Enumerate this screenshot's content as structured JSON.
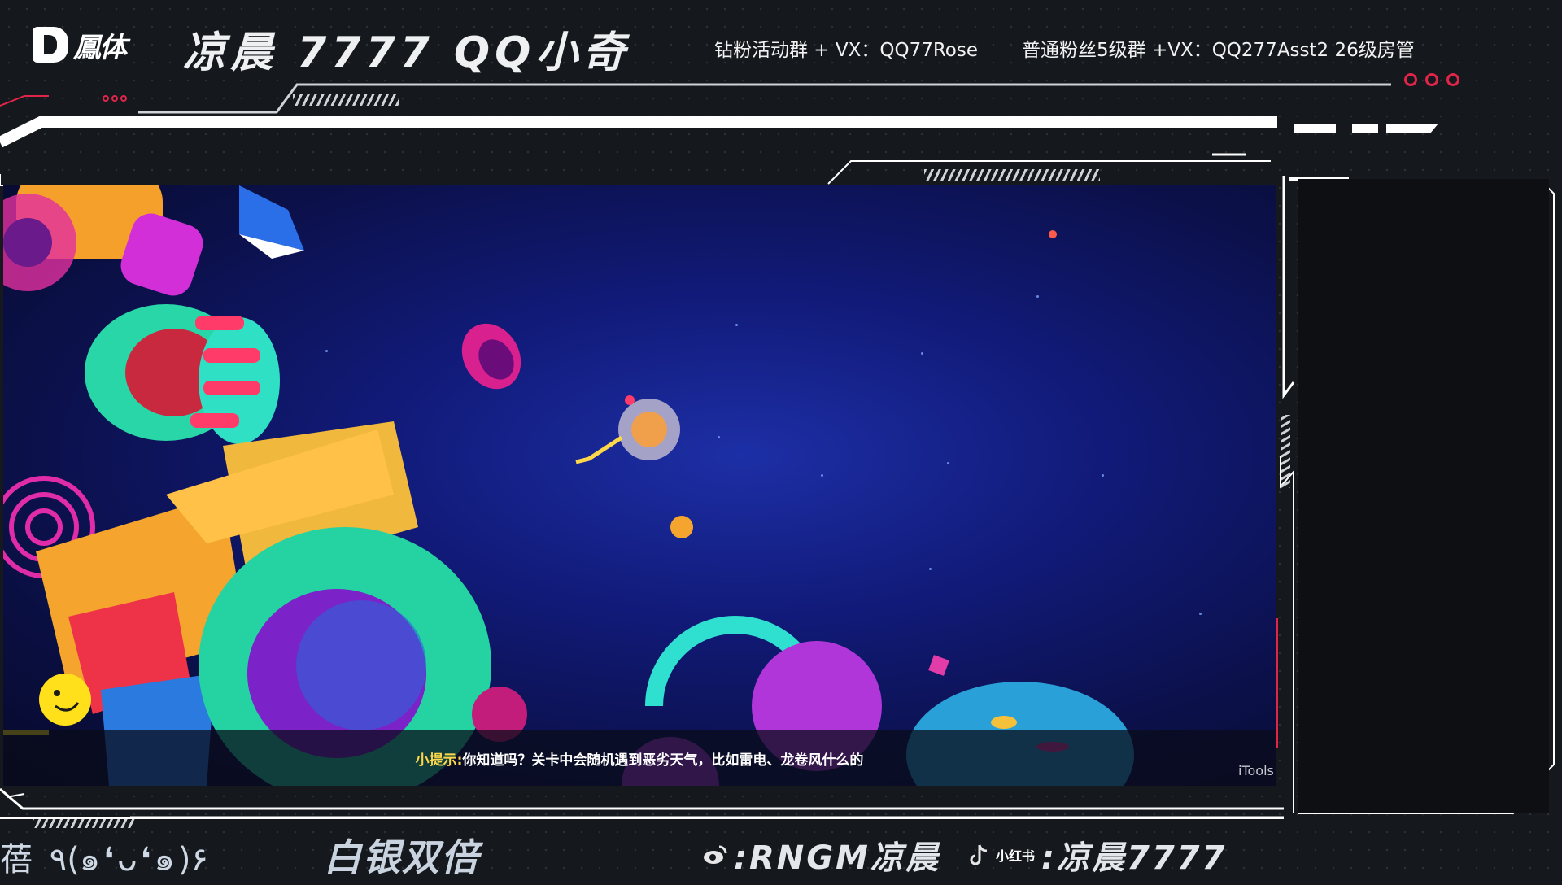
{
  "header": {
    "logo_text": "鳳体",
    "brand_title": "凉晨 7777  QQ小奇",
    "info_diamond": "钻粉活动群 + VX：QQ77Rose",
    "info_normal": "普通粉丝5级群 +VX：QQ277Asst2 26级房管"
  },
  "game": {
    "hint_label": "小提示:",
    "hint_text": "你知道吗？关卡中会随机遇到恶劣天气，比如雷电、龙卷风什么的",
    "watermark": "iTools"
  },
  "footer": {
    "emoticon": "蓓 ٩(๑❛ᴗ❛๑)۶",
    "rank": "白银双倍",
    "weibo_handle": ":RNGM凉晨",
    "xiaohongshu_label": "小红书",
    "douyin_handle": ":凉晨7777"
  },
  "colors": {
    "accent_red": "#e0244a",
    "frame_white": "#ffffff",
    "background": "#15191d"
  },
  "icons": {
    "weibo": "weibo-icon",
    "douyin": "douyin-icon"
  }
}
